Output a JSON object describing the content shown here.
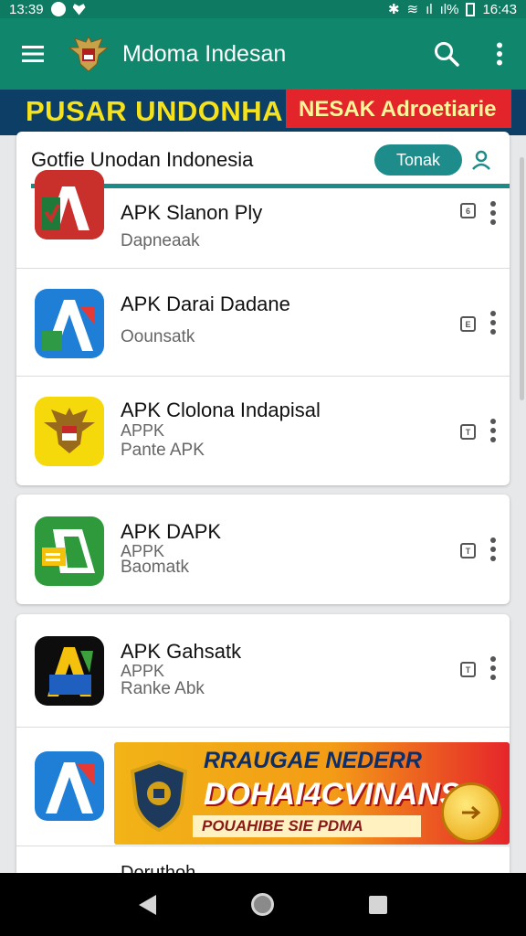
{
  "status_bar": {
    "time_left": "13:39",
    "time_right": "16:43",
    "signal_text": "ıl",
    "percent_text": "ıl%"
  },
  "app_bar": {
    "title": "Mdoma Indesan"
  },
  "promo": {
    "left_text": "PUSAR UNDONHA",
    "right_text": "NESAK Adroetiarie"
  },
  "section": {
    "title": "Gotfie Unodan Indonesia",
    "follow_label": "Tonak"
  },
  "apps": [
    {
      "name": "APK Slanon Ply",
      "sub1": "",
      "sub2": "Dapneaak",
      "badge": "6"
    },
    {
      "name": "APK Darai Dadane",
      "sub1": "",
      "sub2": "Oounsatk",
      "badge": "E"
    },
    {
      "name": "APK Clolona Indapisal",
      "sub1": "APPK",
      "sub2": "Pante APK",
      "badge": "T"
    },
    {
      "name": "APK DAPK",
      "sub1": "APPK",
      "sub2": "Baomatk",
      "badge": "T"
    },
    {
      "name": "APK Gahsatk",
      "sub1": "APPK",
      "sub2": "Ranke Abk",
      "badge": "T"
    },
    {
      "name": "",
      "sub1": "",
      "sub2": "",
      "badge": ""
    },
    {
      "name": "Doruthoh",
      "sub1": "",
      "sub2": "",
      "badge": ""
    }
  ],
  "ad_banner": {
    "line1": "RRAUGAE NEDERR",
    "line2": "DOHAI4CVINANS!",
    "line3": "POUAHIBE SIE PDMA"
  },
  "colors": {
    "primary": "#10876d",
    "accent": "#1d8c8a",
    "promo_bg": "#0d3f66",
    "promo_yellow": "#f6e21a",
    "promo_red": "#e3242b"
  }
}
